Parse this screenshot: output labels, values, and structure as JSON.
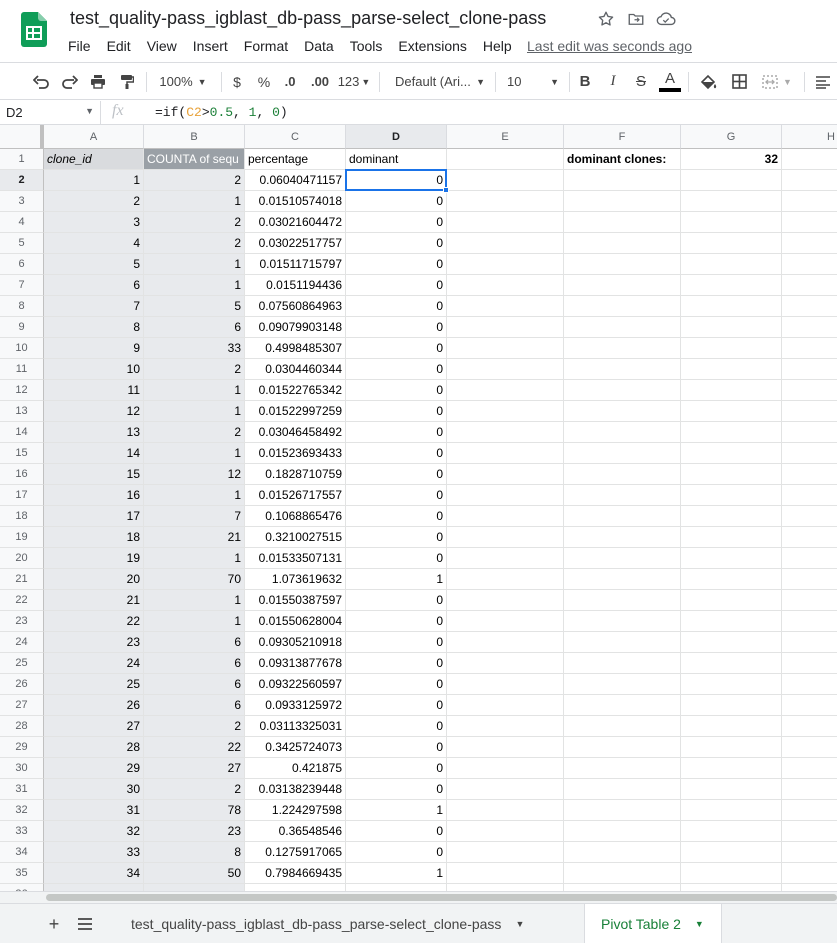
{
  "doc": {
    "title": "test_quality-pass_igblast_db-pass_parse-select_clone-pass",
    "last_edit": "Last edit was seconds ago"
  },
  "menu": [
    "File",
    "Edit",
    "View",
    "Insert",
    "Format",
    "Data",
    "Tools",
    "Extensions",
    "Help"
  ],
  "toolbar": {
    "zoom": "100%",
    "currency": "$",
    "percent": "%",
    "dec_decrease": ".0",
    "dec_increase": ".00",
    "more_formats": "123",
    "font": "Default (Ari...",
    "font_size": "10",
    "bold": "B",
    "italic": "I",
    "strike": "S",
    "text_color": "A"
  },
  "formula_bar": {
    "cell_ref": "D2",
    "fx": "fx",
    "formula_parts": [
      "=if(",
      "C2",
      ">",
      "0.5",
      ", ",
      "1",
      ", ",
      "0",
      ")"
    ]
  },
  "columns": [
    "A",
    "B",
    "C",
    "D",
    "E",
    "F",
    "G",
    "H"
  ],
  "header_row": {
    "clone_id": "clone_id",
    "counta": "COUNTA of sequ",
    "percentage": "percentage",
    "dominant": "dominant",
    "dominant_clones_label": "dominant clones:",
    "dominant_clones_value": "32"
  },
  "rows": [
    [
      "1",
      "2",
      "0.06040471157",
      "0"
    ],
    [
      "2",
      "1",
      "0.01510574018",
      "0"
    ],
    [
      "3",
      "2",
      "0.03021604472",
      "0"
    ],
    [
      "4",
      "2",
      "0.03022517757",
      "0"
    ],
    [
      "5",
      "1",
      "0.01511715797",
      "0"
    ],
    [
      "6",
      "1",
      "0.0151194436",
      "0"
    ],
    [
      "7",
      "5",
      "0.07560864963",
      "0"
    ],
    [
      "8",
      "6",
      "0.09079903148",
      "0"
    ],
    [
      "9",
      "33",
      "0.4998485307",
      "0"
    ],
    [
      "10",
      "2",
      "0.0304460344",
      "0"
    ],
    [
      "11",
      "1",
      "0.01522765342",
      "0"
    ],
    [
      "12",
      "1",
      "0.01522997259",
      "0"
    ],
    [
      "13",
      "2",
      "0.03046458492",
      "0"
    ],
    [
      "14",
      "1",
      "0.01523693433",
      "0"
    ],
    [
      "15",
      "12",
      "0.1828710759",
      "0"
    ],
    [
      "16",
      "1",
      "0.01526717557",
      "0"
    ],
    [
      "17",
      "7",
      "0.1068865476",
      "0"
    ],
    [
      "18",
      "21",
      "0.3210027515",
      "0"
    ],
    [
      "19",
      "1",
      "0.01533507131",
      "0"
    ],
    [
      "20",
      "70",
      "1.073619632",
      "1"
    ],
    [
      "21",
      "1",
      "0.01550387597",
      "0"
    ],
    [
      "22",
      "1",
      "0.01550628004",
      "0"
    ],
    [
      "23",
      "6",
      "0.09305210918",
      "0"
    ],
    [
      "24",
      "6",
      "0.09313877678",
      "0"
    ],
    [
      "25",
      "6",
      "0.09322560597",
      "0"
    ],
    [
      "26",
      "6",
      "0.0933125972",
      "0"
    ],
    [
      "27",
      "2",
      "0.03113325031",
      "0"
    ],
    [
      "28",
      "22",
      "0.3425724073",
      "0"
    ],
    [
      "29",
      "27",
      "0.421875",
      "0"
    ],
    [
      "30",
      "2",
      "0.03138239448",
      "0"
    ],
    [
      "31",
      "78",
      "1.224297598",
      "1"
    ],
    [
      "32",
      "23",
      "0.36548546",
      "0"
    ],
    [
      "33",
      "8",
      "0.1275917065",
      "0"
    ],
    [
      "34",
      "50",
      "0.7984669435",
      "1"
    ]
  ],
  "sheets": [
    {
      "name": "test_quality-pass_igblast_db-pass_parse-select_clone-pass",
      "active": false
    },
    {
      "name": "Pivot Table 2",
      "active": true
    }
  ],
  "colors": {
    "accent": "#1a73e8",
    "sheets_green": "#0f9d58",
    "active_tab": "#188038",
    "pivot_header": "#9aa0a6",
    "pivot_col": "#e8eaed"
  }
}
